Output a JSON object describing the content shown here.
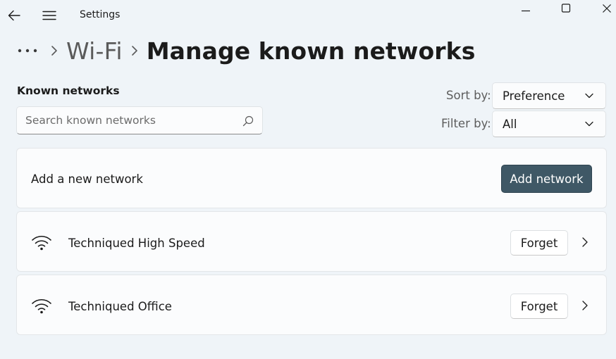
{
  "window": {
    "title": "Settings",
    "icons": {
      "back": "back-arrow-icon",
      "menu": "hamburger-menu-icon",
      "minimize": "minimize-icon",
      "maximize": "maximize-icon",
      "close": "close-icon"
    }
  },
  "breadcrumb": {
    "more_icon": "more-ellipsis-icon",
    "parent": "Wi-Fi",
    "current": "Manage known networks"
  },
  "known_networks": {
    "label": "Known networks",
    "search": {
      "placeholder": "Search known networks",
      "value": "",
      "icon": "search-icon"
    }
  },
  "sort": {
    "label": "Sort by:",
    "selected": "Preference"
  },
  "filter": {
    "label": "Filter by:",
    "selected": "All"
  },
  "add_network": {
    "label": "Add a new network",
    "button": "Add network"
  },
  "networks": [
    {
      "name": "Techniqued High Speed",
      "forget_label": "Forget",
      "icon": "wifi-icon"
    },
    {
      "name": "Techniqued Office",
      "forget_label": "Forget",
      "icon": "wifi-icon"
    }
  ],
  "colors": {
    "background": "#eff4f8",
    "card": "#fbfcfd",
    "accent_button": "#3f5866",
    "text": "#1b1b1b"
  }
}
